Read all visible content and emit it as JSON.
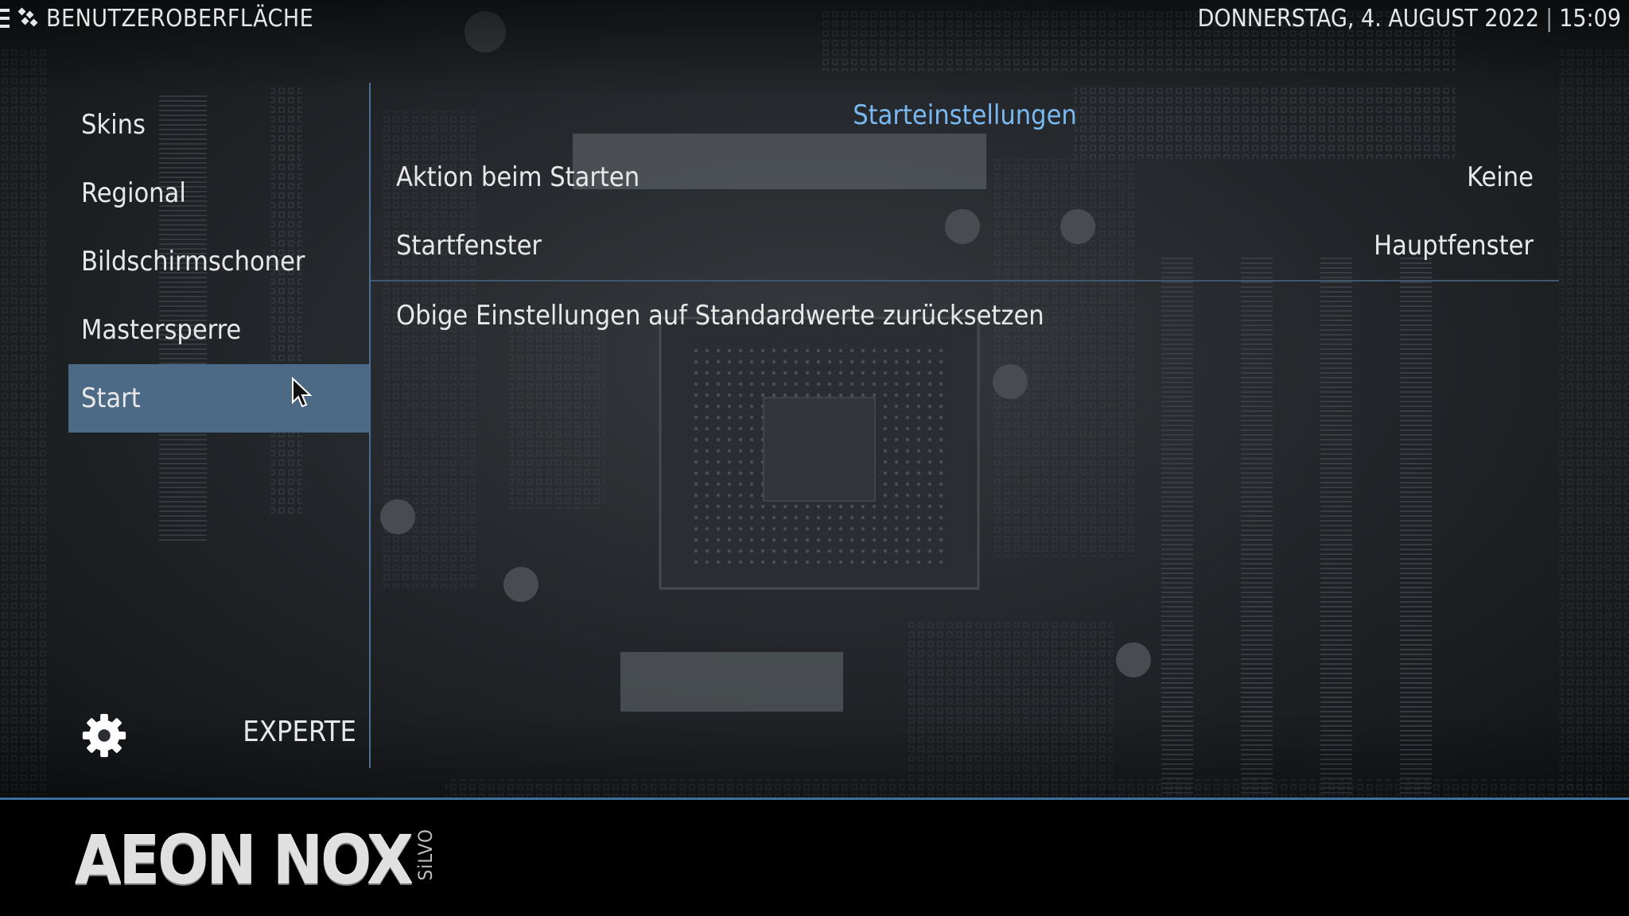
{
  "header": {
    "section_title": "BENUTZEROBERFLÄCHE",
    "date": "DONNERSTAG, 4. AUGUST 2022",
    "separator": "|",
    "time": "15:09"
  },
  "sidebar": {
    "items": [
      {
        "label": "Skins",
        "active": false
      },
      {
        "label": "Regional",
        "active": false
      },
      {
        "label": "Bildschirmschoner",
        "active": false
      },
      {
        "label": "Mastersperre",
        "active": false
      },
      {
        "label": "Start",
        "active": true
      }
    ],
    "expert_label": "EXPERTE"
  },
  "content": {
    "title": "Starteinstellungen",
    "rows": [
      {
        "label": "Aktion beim Starten",
        "value": "Keine"
      },
      {
        "label": "Startfenster",
        "value": "Hauptfenster"
      },
      {
        "label": "Obige Einstellungen auf Standardwerte zurücksetzen",
        "value": ""
      }
    ]
  },
  "branding": {
    "logo_main": "AEON NOX",
    "logo_sub": "SiLVO"
  },
  "colors": {
    "accent": "#79b8f0",
    "active_bg": "#4c6a86",
    "divider": "#4a6f92"
  },
  "icons": {
    "menu": "hamburger-icon",
    "app": "kodi-logo-icon",
    "settings": "gear-icon",
    "pointer": "mouse-cursor-icon"
  }
}
